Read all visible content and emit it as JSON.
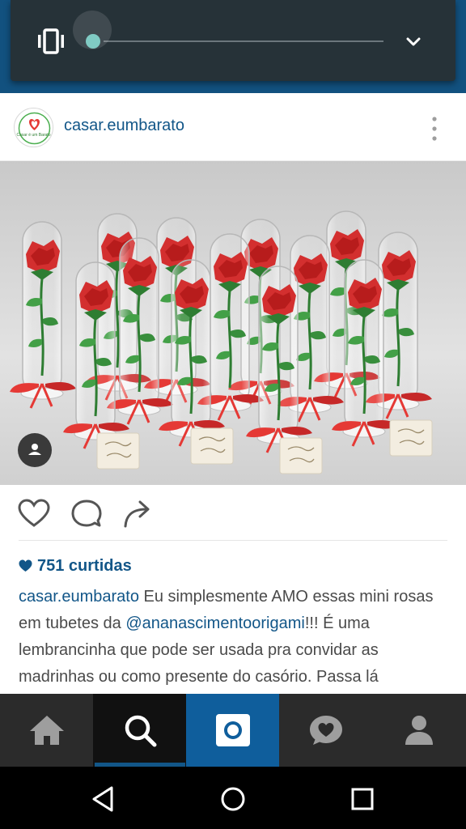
{
  "post": {
    "username": "casar.eumbarato",
    "avatar_text": "Casar é um Barato",
    "likes": "751 curtidas",
    "caption": {
      "username": "casar.eumbarato",
      "text_1": " Eu simplesmente AMO essas mini rosas em tubetes da ",
      "mention": "@ananascimentoorigami",
      "text_2": "!!! É uma lembrancinha que pode ser usada pra convidar as madrinhas ou como presente do casório. Passa lá"
    }
  },
  "volume_panel": {
    "icon": "vibrate-icon",
    "expand_icon": "chevron-down-icon",
    "level": 0
  },
  "bottom_nav": {
    "items": [
      "home-icon",
      "search-icon",
      "camera-icon",
      "activity-icon",
      "profile-icon"
    ],
    "selected": "search-icon"
  },
  "system_nav": {
    "items": [
      "back-icon",
      "home-circle-icon",
      "recents-icon"
    ]
  },
  "colors": {
    "link": "#125688",
    "status_bar": "#12517f",
    "volume_panel": "#263238",
    "slider_accent": "#80cbc4",
    "nav_bg": "#2b2b2b",
    "nav_selected": "#111111",
    "camera_tab": "#0f5e9c"
  }
}
